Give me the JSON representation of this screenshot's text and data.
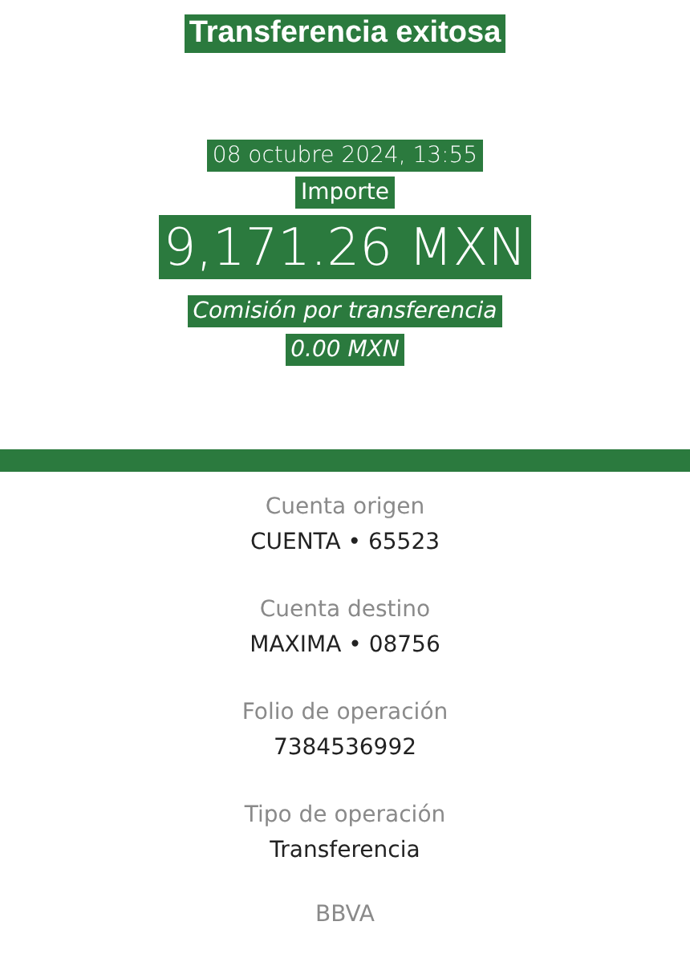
{
  "header": {
    "title": "Transferencia exitosa",
    "date": "08 octubre 2024, 13:55",
    "amount_label": "Importe",
    "amount": "9,171.26 MXN",
    "fee_label": "Comisión por transferencia",
    "fee": "0.00 MXN"
  },
  "details": [
    {
      "label": "Cuenta origen",
      "value": "CUENTA • 65523"
    },
    {
      "label": "Cuenta destino",
      "value": "MAXIMA • 08756"
    },
    {
      "label": "Folio de operación",
      "value": "7384536992"
    },
    {
      "label": "Tipo de operación",
      "value": "Transferencia"
    }
  ],
  "footer": "BBVA"
}
